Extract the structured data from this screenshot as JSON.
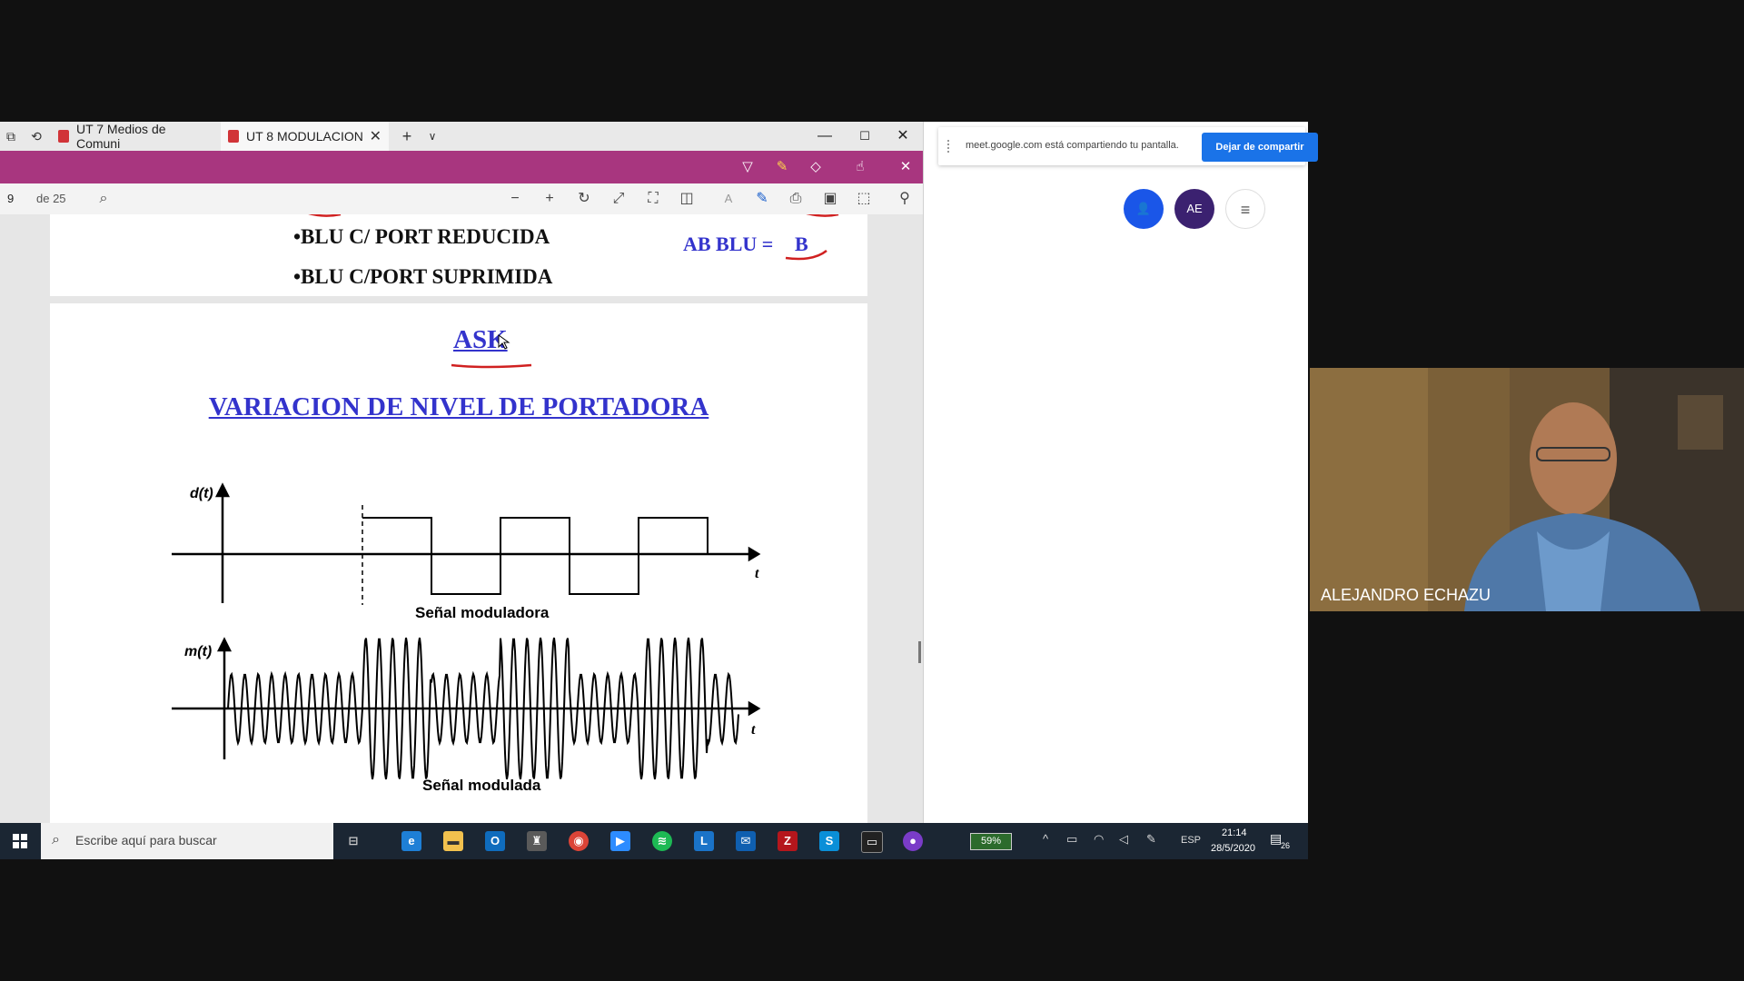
{
  "browser": {
    "tabs": [
      {
        "label": "UT 7 Medios de Comuni"
      },
      {
        "label": "UT 8 MODULACION"
      }
    ],
    "new_tab": "+",
    "tab_menu": "∨"
  },
  "pdf_toolbar": {
    "page_current": "9",
    "page_total": "de 25"
  },
  "page1": {
    "bullet1": "•BLU C/ PORT REDUCIDA",
    "bullet2": "•BLU C/PORT SUPRIMIDA",
    "ab_label": "AB BLU =",
    "ab_value": "B"
  },
  "page2": {
    "title": "ASK",
    "subtitle": "VARIACION DE NIVEL DE PORTADORA",
    "diagram": {
      "top_y_label": "d(t)",
      "top_x_label": "t",
      "top_caption": "Señal moduladora",
      "bottom_y_label": "m(t)",
      "bottom_x_label": "t",
      "bottom_caption": "Señal modulada",
      "bits": [
        1,
        0,
        1,
        0,
        1
      ]
    }
  },
  "meet": {
    "share_text": "meet.google.com está compartiendo tu pantalla.",
    "stop_button": "Dejar de compartir",
    "avatar_initials": "AE",
    "participant_name": "ALEJANDRO ECHAZU"
  },
  "taskbar": {
    "search_placeholder": "Escribe aquí para buscar",
    "battery": "59%",
    "language": "ESP",
    "time": "21:14",
    "date": "28/5/2020",
    "notifications": "26"
  },
  "colors": {
    "ink_toolbar": "#a8367f",
    "accent_blue": "#1a73e8",
    "doc_blue": "#3333cc",
    "taskbar": "#1b2633"
  }
}
